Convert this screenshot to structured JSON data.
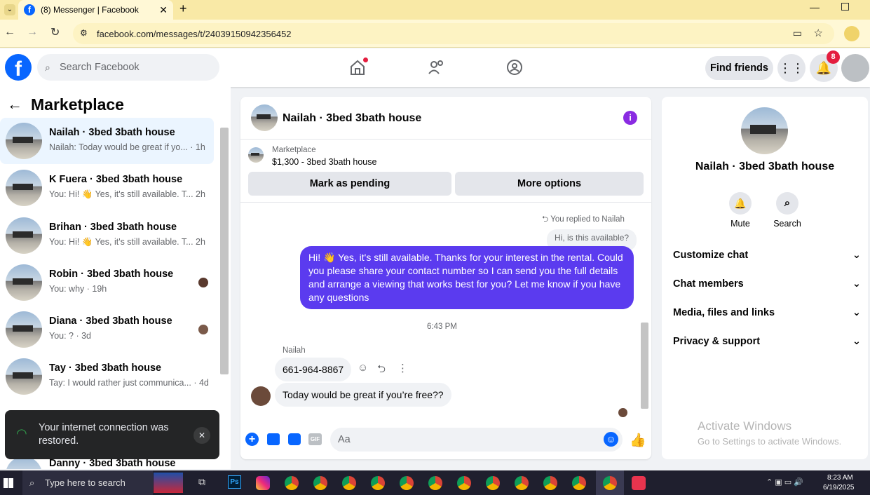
{
  "browser": {
    "tab_title": "(8) Messenger | Facebook",
    "url": "facebook.com/messages/t/24039150942356452"
  },
  "header": {
    "search_placeholder": "Search Facebook",
    "find_friends": "Find friends",
    "notification_count": "8"
  },
  "left": {
    "title": "Marketplace",
    "conversations": [
      {
        "title": "Nailah · 3bed 3bath house",
        "sub": "Nailah: Today would be great if yo... · 1h"
      },
      {
        "title": "K Fuera · 3bed 3bath house",
        "sub": "You: Hi! 👋 Yes, it's still available. T... 2h"
      },
      {
        "title": "Brihan · 3bed 3bath house",
        "sub": "You: Hi! 👋 Yes, it's still available. T... 2h"
      },
      {
        "title": "Robin · 3bed 3bath house",
        "sub": "You: why · 19h"
      },
      {
        "title": "Diana · 3bed 3bath house",
        "sub": "You: ? · 3d"
      },
      {
        "title": "Tay · 3bed 3bath house",
        "sub": "Tay: I would rather just communica... · 4d"
      },
      {
        "title": "Danny · 3bed 3bath house",
        "sub": ""
      }
    ],
    "toast": "Your internet connection was restored."
  },
  "chat": {
    "title": "Nailah · 3bed 3bath house",
    "listing_label": "Marketplace",
    "listing_price": "$1,300 - 3bed 3bath house",
    "mark_pending": "Mark as pending",
    "more_options": "More options",
    "replied_to": "You replied to Nailah",
    "quoted": "Hi, is this available?",
    "outgoing": "Hi! 👋 Yes, it's still available. Thanks for your interest in the rental. Could you please share your contact number so I can send you the full details and arrange a viewing that works best for you? Let me know if you have any questions",
    "timestamp": "6:43 PM",
    "sender": "Nailah",
    "msg1": "661-964-8867",
    "msg2": "Today would be great if you’re free??",
    "composer_placeholder": "Aa"
  },
  "right": {
    "name": "Nailah · 3bed 3bath house",
    "mute": "Mute",
    "search": "Search",
    "options": [
      "Customize chat",
      "Chat members",
      "Media, files and links",
      "Privacy & support"
    ],
    "watermark_title": "Activate Windows",
    "watermark_sub": "Go to Settings to activate Windows."
  },
  "taskbar": {
    "search_placeholder": "Type here to search",
    "time": "8:23 AM",
    "date": "6/19/2025"
  },
  "colors": {
    "fb_blue": "#0866ff",
    "messenger_purple": "#5b3bef",
    "accent_purple": "#8a2be2"
  }
}
